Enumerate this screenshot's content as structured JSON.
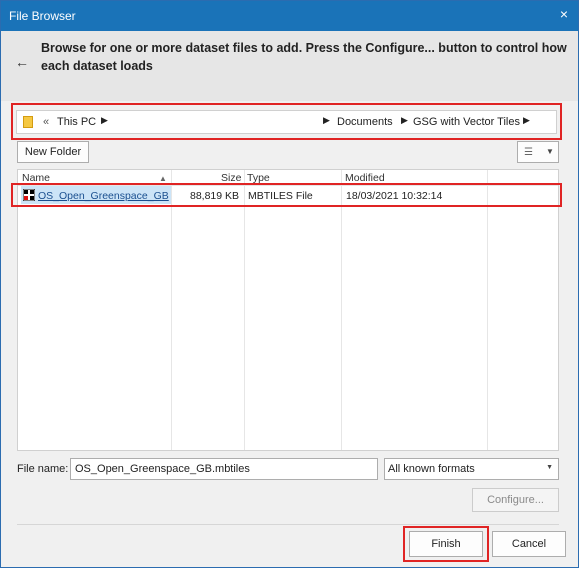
{
  "window": {
    "title": "File Browser",
    "close_symbol": "×"
  },
  "header": {
    "instruction": "Browse for one or more dataset files to add. Press the Configure... button to control how each dataset loads"
  },
  "breadcrumb": {
    "overflow": "«",
    "segments": [
      "This PC",
      "Documents",
      "GSG with Vector Tiles"
    ]
  },
  "toolbar": {
    "new_folder_label": "New Folder"
  },
  "list": {
    "columns": {
      "name": "Name",
      "size": "Size",
      "type": "Type",
      "modified": "Modified"
    },
    "rows": [
      {
        "name": "OS_Open_Greenspace_GB",
        "size": "88,819 KB",
        "type": "MBTILES File",
        "modified": "18/03/2021 10:32:14"
      }
    ]
  },
  "footer": {
    "file_name_label": "File name:",
    "file_name_value": "OS_Open_Greenspace_GB.mbtiles",
    "format_selected": "All known formats",
    "configure_label": "Configure...",
    "finish_label": "Finish",
    "cancel_label": "Cancel"
  },
  "colors": {
    "titlebar": "#1a73b8",
    "highlight_outline": "#e02424",
    "selection": "#cce4f7"
  },
  "icons": [
    "close-icon",
    "back-arrow-icon",
    "folder-icon",
    "chevron-right-icon",
    "list-view-icon",
    "chevron-down-icon",
    "sort-up-icon",
    "mbtiles-file-icon"
  ]
}
